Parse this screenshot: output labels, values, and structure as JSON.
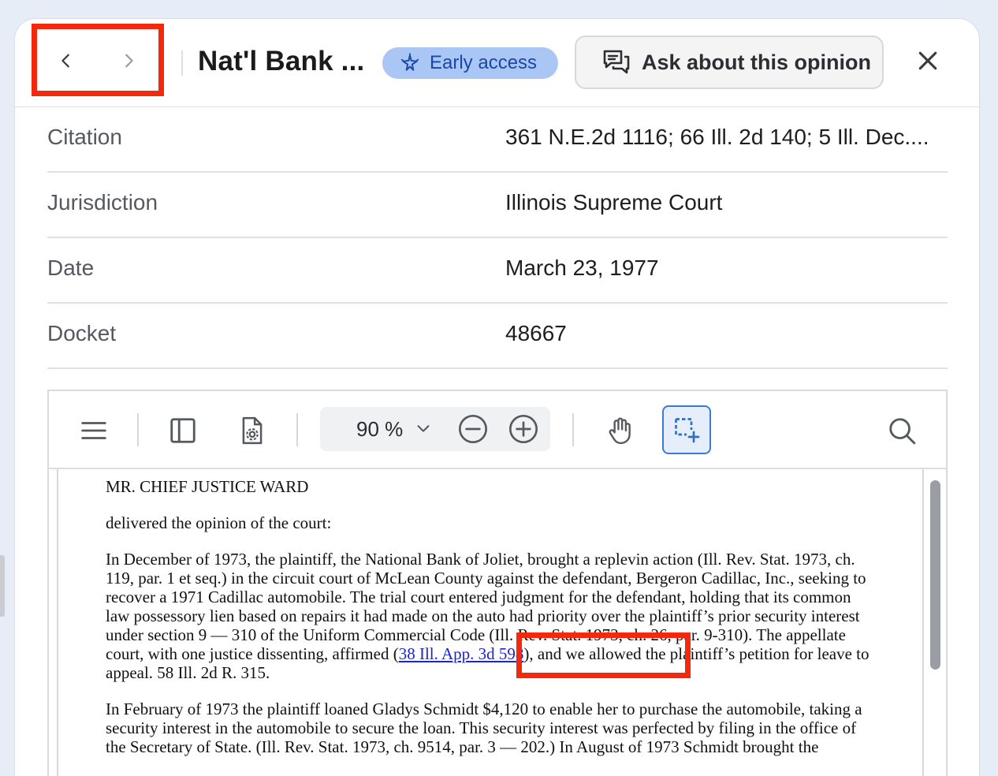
{
  "header": {
    "title": "Nat'l Bank ...",
    "badge_label": "Early access",
    "ask_label": "Ask about this opinion"
  },
  "meta": [
    {
      "label": "Citation",
      "value": "361 N.E.2d 1116; 66 Ill. 2d 140; 5 Ill. Dec...."
    },
    {
      "label": "Jurisdiction",
      "value": "Illinois Supreme Court"
    },
    {
      "label": "Date",
      "value": "March 23, 1977"
    },
    {
      "label": "Docket",
      "value": "48667"
    }
  ],
  "viewer": {
    "zoom": "90 %"
  },
  "document": {
    "judge": "MR. CHIEF JUSTICE WARD",
    "delivered": "delivered the opinion of the court:",
    "p1_start": "In December of 1973, the plaintiff, the National Bank of Joliet, brought a replevin action (Ill. Rev. Stat. 1973, ch. 119, par. 1 et seq.) in the circuit court of McLean County against the defendant, Bergeron Cadillac, Inc., seeking to recover a 1971 Cadillac automobile. The trial court entered judgment for the defendant, holding that its common law possessory lien based on repairs it had made on the auto had priority over the plaintiff’s prior security interest under section 9 — 310 of the Uniform Commercial Code (Ill. Rev. Stat. 1973, ch. 26, par. 9-310). The appellate court, with one justice dissenting, affirmed (",
    "p1_link": "38 Ill. App. 3d 598",
    "p1_end": "), and we allowed the plaintiff’s petition for leave to appeal. 58 Ill. 2d R. 315.",
    "p2": "In February of 1973 the plaintiff loaned Gladys Schmidt $4,120 to enable her to purchase the automobile, taking a security interest in the automobile to secure the loan. This security interest was perfected by filing in the office of the Secretary of State. (Ill. Rev. Stat. 1973, ch. 9514, par. 3 — 202.) In August of 1973 Schmidt brought the"
  },
  "colors": {
    "highlight": "#f2290c",
    "badge_bg": "#a9c6f5",
    "badge_text": "#1a47a8",
    "link": "#1a23d6"
  },
  "icons": [
    "chevron-left-icon",
    "chevron-right-icon",
    "sparkle-icon",
    "chat-bubbles-icon",
    "close-icon",
    "menu-icon",
    "sidebar-icon",
    "document-settings-icon",
    "chevron-down-icon",
    "zoom-out-icon",
    "zoom-in-icon",
    "hand-icon",
    "area-select-icon",
    "search-icon"
  ]
}
